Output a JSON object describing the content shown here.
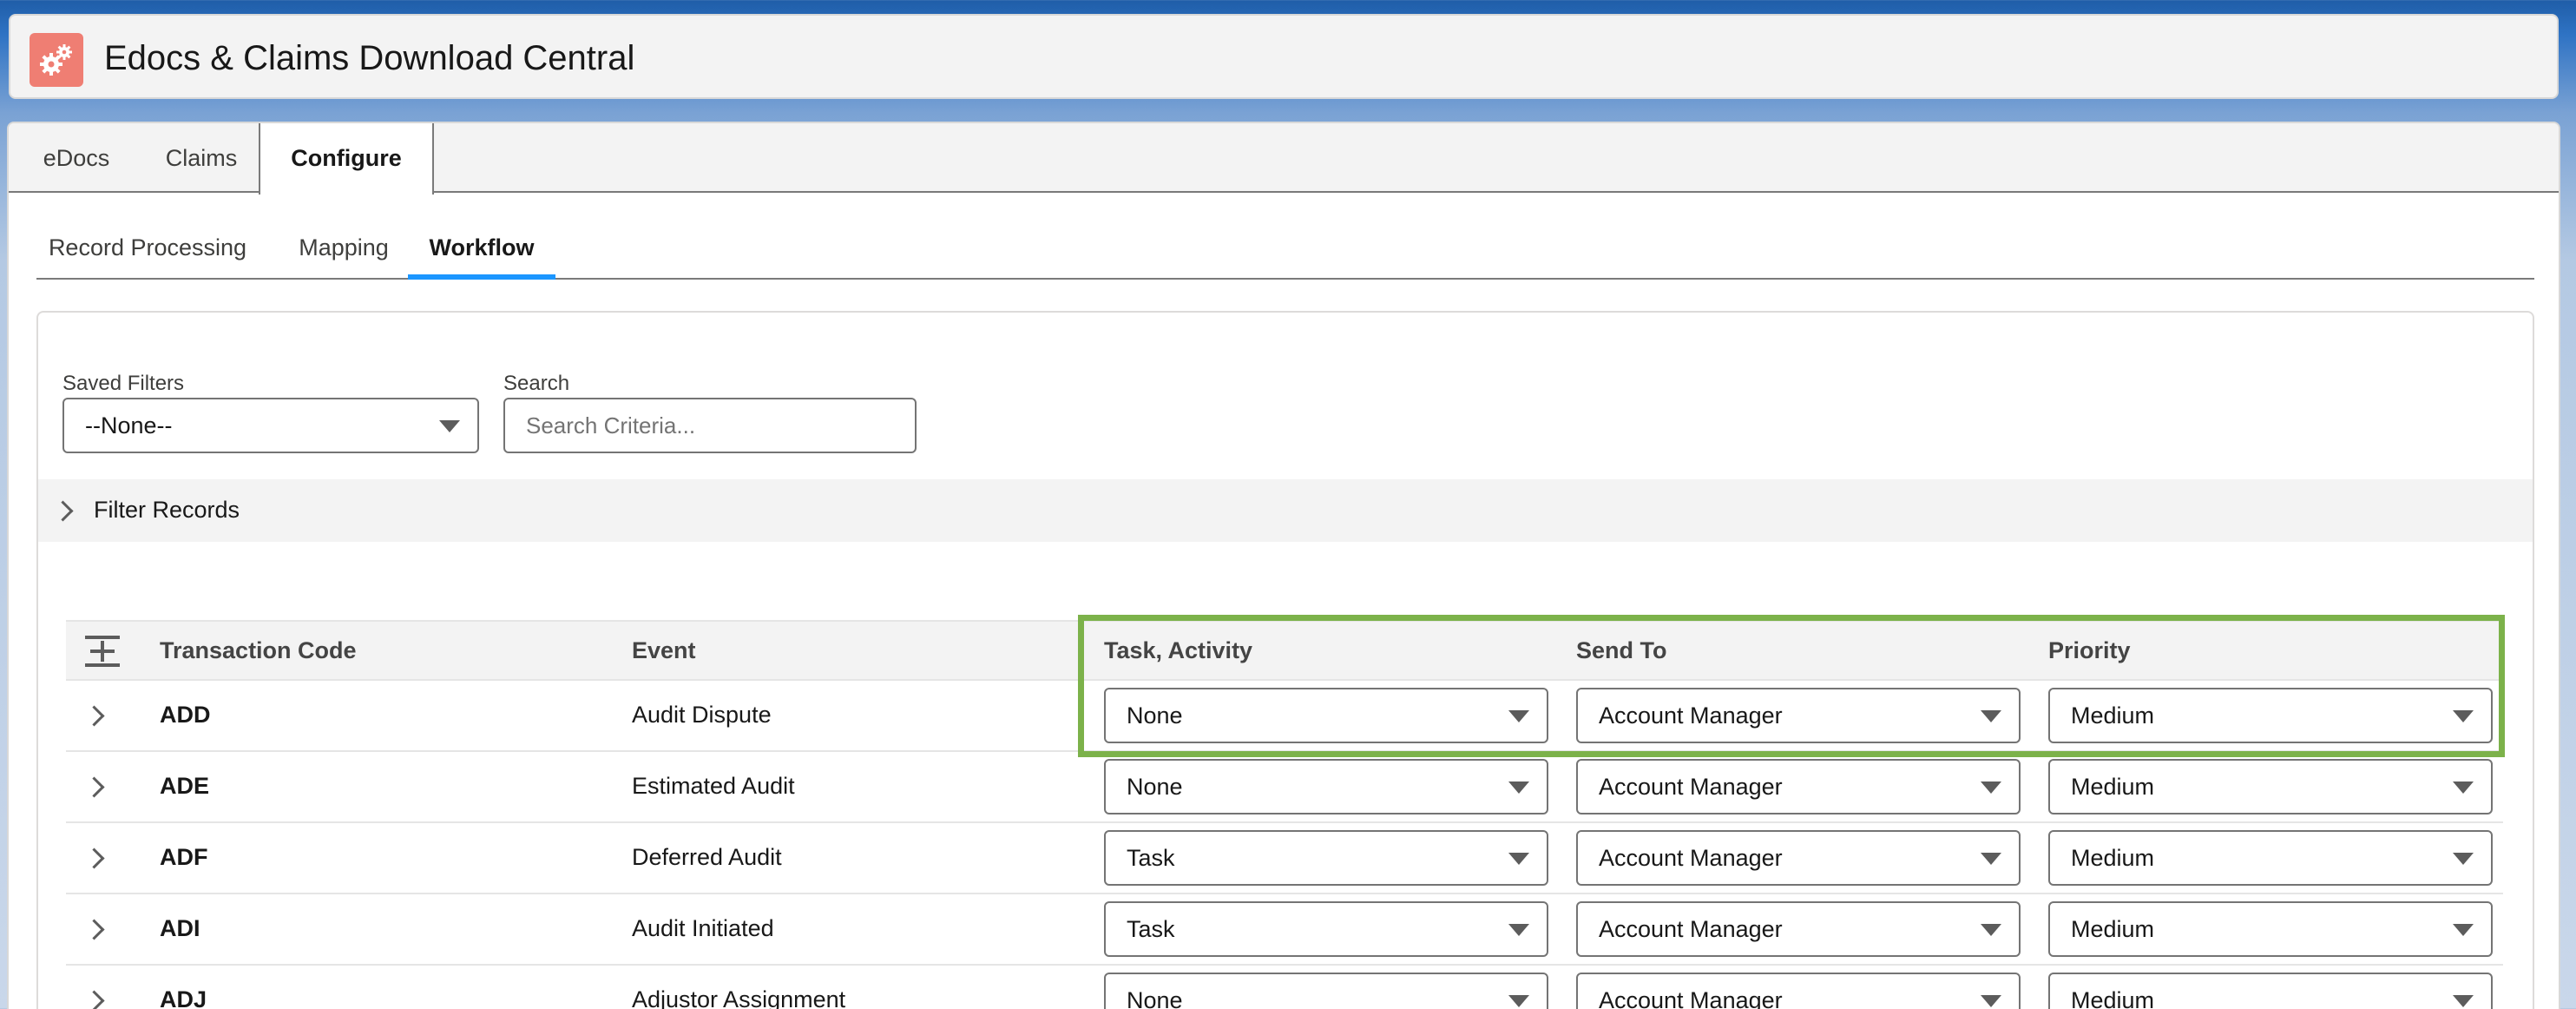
{
  "app": {
    "title": "Edocs & Claims Download Central",
    "logo_icon": "gears-icon",
    "logo_color": "#ef7e73"
  },
  "tabs": [
    {
      "label": "eDocs",
      "active": false
    },
    {
      "label": "Claims",
      "active": false
    },
    {
      "label": "Configure",
      "active": true
    }
  ],
  "subtabs": [
    {
      "label": "Record Processing",
      "active": false
    },
    {
      "label": "Mapping",
      "active": false
    },
    {
      "label": "Workflow",
      "active": true
    }
  ],
  "filters": {
    "saved_filters_label": "Saved Filters",
    "saved_filters_value": "--None--",
    "search_label": "Search",
    "search_placeholder": "Search Criteria...",
    "filter_records_label": "Filter Records"
  },
  "table": {
    "headers": {
      "code": "Transaction Code",
      "event": "Event",
      "task": "Task, Activity",
      "send_to": "Send To",
      "priority": "Priority"
    },
    "rows": [
      {
        "code": "ADD",
        "event": "Audit Dispute",
        "task": "None",
        "send_to": "Account Manager",
        "priority": "Medium"
      },
      {
        "code": "ADE",
        "event": "Estimated Audit",
        "task": "None",
        "send_to": "Account Manager",
        "priority": "Medium"
      },
      {
        "code": "ADF",
        "event": "Deferred Audit",
        "task": "Task",
        "send_to": "Account Manager",
        "priority": "Medium"
      },
      {
        "code": "ADI",
        "event": "Audit Initiated",
        "task": "Task",
        "send_to": "Account Manager",
        "priority": "Medium"
      },
      {
        "code": "ADJ",
        "event": "Adjustor Assignment",
        "task": "None",
        "send_to": "Account Manager",
        "priority": "Medium"
      }
    ]
  },
  "colors": {
    "accent": "#1b96ff",
    "highlight": "#7cb24a"
  }
}
